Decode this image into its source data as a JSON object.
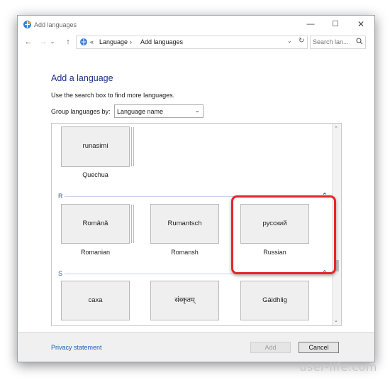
{
  "window": {
    "title": "Add languages"
  },
  "controls": {
    "minimize": "—",
    "maximize": "☐",
    "close": "✕"
  },
  "nav": {
    "back": "←",
    "forward": "→",
    "recent": "⌄",
    "up": "↑"
  },
  "address": {
    "sep0": "«",
    "crumb1": "Language",
    "sep1": "›",
    "crumb2": "Add languages",
    "dropdown": "⌄",
    "refresh": "↻"
  },
  "search": {
    "placeholder": "Search lan..."
  },
  "main": {
    "heading": "Add a language",
    "instructions": "Use the search box to find more languages.",
    "group_label": "Group languages by:",
    "group_value": "Language name"
  },
  "list": {
    "sections": [
      {
        "letter": "R"
      },
      {
        "letter": "S"
      }
    ],
    "tiles": [
      {
        "native": "runasimi",
        "caption": "Quechua"
      },
      {
        "native": "Română",
        "caption": "Romanian"
      },
      {
        "native": "Rumantsch",
        "caption": "Romansh"
      },
      {
        "native": "русский",
        "caption": "Russian"
      },
      {
        "native": "саха",
        "caption": ""
      },
      {
        "native": "संस्कृतम्",
        "caption": ""
      },
      {
        "native": "Gàidhlig",
        "caption": ""
      }
    ]
  },
  "footer": {
    "privacy": "Privacy statement",
    "add": "Add",
    "cancel": "Cancel"
  },
  "watermark": "user-life.com",
  "colors": {
    "accent": "#1e3287",
    "link": "#1a5fbf",
    "highlight": "#e8242b"
  }
}
